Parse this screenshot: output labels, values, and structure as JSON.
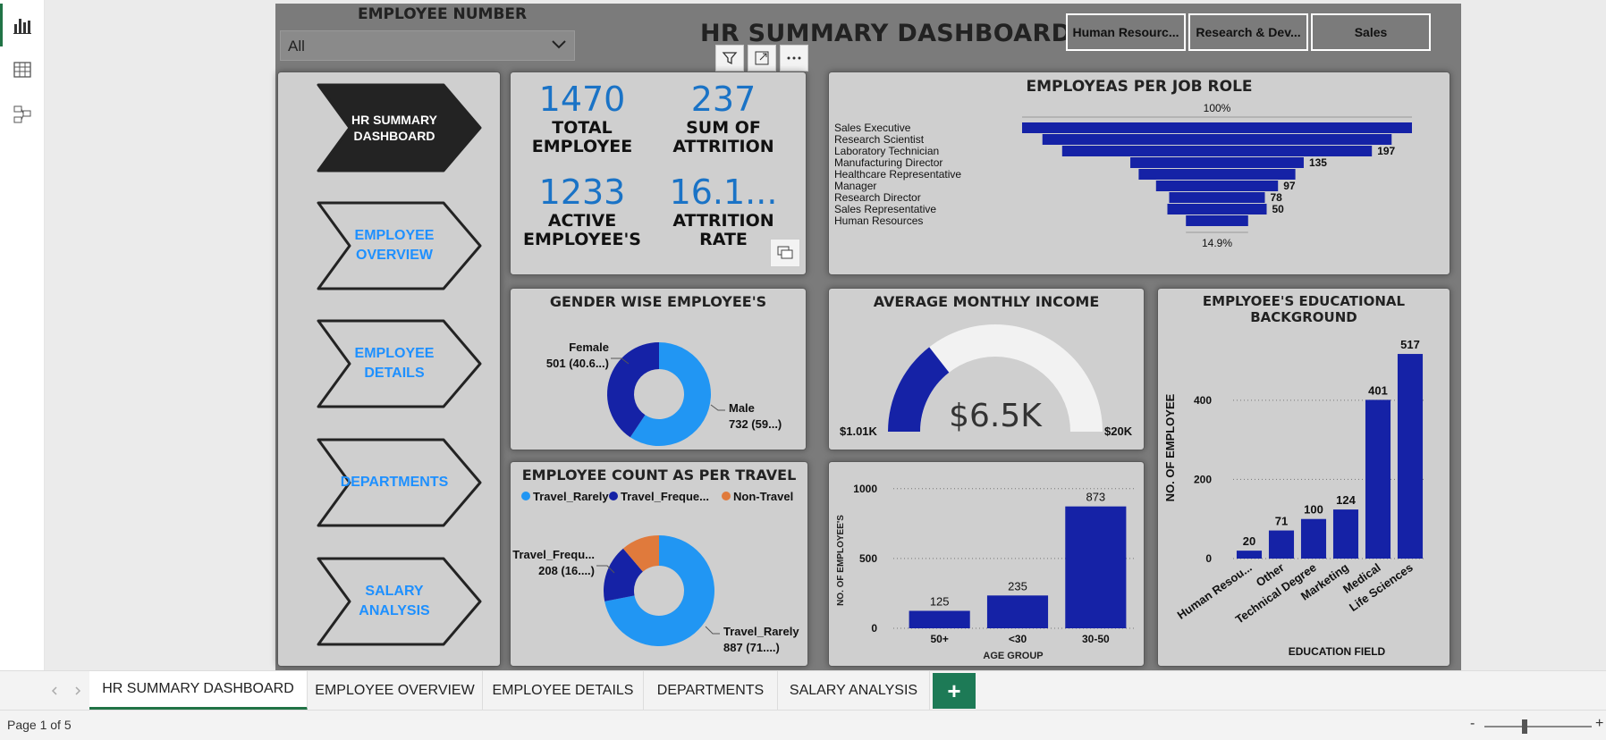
{
  "header": {
    "slicer_label": "EMPLOYEE NUMBER",
    "slicer_value": "All",
    "title": "HR SUMMARY DASHBOARD",
    "dept_buttons": [
      "Human Resourc...",
      "Research & Dev...",
      "Sales"
    ]
  },
  "nav": [
    {
      "label": "HR SUMMARY DASHBOARD",
      "active": true
    },
    {
      "label": "EMPLOYEE OVERVIEW",
      "active": false
    },
    {
      "label": "EMPLOYEE DETAILS",
      "active": false
    },
    {
      "label": "DEPARTMENTS",
      "active": false
    },
    {
      "label": "SALARY ANALYSIS",
      "active": false
    }
  ],
  "kpis": {
    "total_employee": {
      "value": "1470",
      "label1": "TOTAL",
      "label2": "EMPLOYEE"
    },
    "attrition": {
      "value": "237",
      "label1": "SUM OF",
      "label2": "ATTRITION"
    },
    "active": {
      "value": "1233",
      "label1": "ACTIVE",
      "label2": "EMPLOYEE'S"
    },
    "rate": {
      "value": "16.1...",
      "label1": "ATTRITION",
      "label2": "RATE"
    }
  },
  "colors": {
    "dark_blue": "#1522a6",
    "light_blue": "#2196f3",
    "orange": "#e07a3c",
    "accent_green": "#217346"
  },
  "chart_data": [
    {
      "id": "funnel",
      "type": "bar",
      "title": "EMPLOYEAS PER JOB ROLE",
      "top_label": "100%",
      "bottom_label": "14.9%",
      "categories": [
        "Sales Executive",
        "Research Scientist",
        "Laboratory Technician",
        "Manufacturing Director",
        "Healthcare Representative",
        "Manager",
        "Research Director",
        "Sales Representative",
        "Human Resources"
      ],
      "values": [
        326,
        292,
        259,
        145,
        131,
        102,
        80,
        83,
        52
      ],
      "data_labels": [
        "",
        "",
        "197",
        "135",
        "",
        "97",
        "78",
        "50",
        ""
      ]
    },
    {
      "id": "gender",
      "type": "pie",
      "title": "GENDER WISE EMPLOYEE'S",
      "slices": [
        {
          "name": "Female",
          "value": 501,
          "label": "501 (40.6...)",
          "color": "#1522a6"
        },
        {
          "name": "Male",
          "value": 732,
          "label": "732 (59...)",
          "color": "#2196f3"
        }
      ]
    },
    {
      "id": "income",
      "type": "gauge",
      "title": "AVERAGE MONTHLY INCOME",
      "value": 6.5,
      "min": 1.01,
      "max": 20,
      "value_label": "$6.5K",
      "min_label": "$1.01K",
      "max_label": "$20K"
    },
    {
      "id": "education",
      "type": "bar",
      "title": "EMPLYOEE'S EDUCATIONAL BACKGROUND",
      "xlabel": "EDUCATION FIELD",
      "ylabel": "NO. OF EMPLOYEE",
      "categories": [
        "Human Resou...",
        "Other",
        "Technical Degree",
        "Marketing",
        "Medical",
        "Life Sciences"
      ],
      "values": [
        20,
        71,
        100,
        124,
        401,
        517
      ],
      "yticks": [
        0,
        200,
        400
      ],
      "ylim": [
        0,
        560
      ]
    },
    {
      "id": "travel",
      "type": "pie",
      "title": "EMPLOYEE COUNT AS PER TRAVEL",
      "legend": [
        "Travel_Rarely",
        "Travel_Freque...",
        "Non-Travel"
      ],
      "slices": [
        {
          "name": "Travel_Rarely",
          "value": 887,
          "label": "887 (71....)",
          "color": "#2196f3"
        },
        {
          "name": "Travel_Frequently",
          "value": 208,
          "label": "208 (16....)",
          "color": "#1522a6"
        },
        {
          "name": "Non-Travel",
          "value": 138,
          "label": "",
          "color": "#e07a3c"
        }
      ],
      "callouts": [
        "Travel_Frequ...",
        "Travel_Rarely"
      ]
    },
    {
      "id": "age",
      "type": "bar",
      "xlabel": "AGE GROUP",
      "ylabel": "NO. OF EMPLOYEE'S",
      "categories": [
        "50+",
        "<30",
        "30-50"
      ],
      "values": [
        125,
        235,
        873
      ],
      "yticks": [
        0,
        500,
        1000
      ],
      "ylim": [
        0,
        1050
      ]
    }
  ],
  "tabs": [
    "HR SUMMARY DASHBOARD",
    "EMPLOYEE OVERVIEW",
    "EMPLOYEE DETAILS",
    "DEPARTMENTS",
    "SALARY ANALYSIS"
  ],
  "tab_add": "+",
  "status": {
    "page": "Page 1 of 5",
    "zoom_minus": "-",
    "zoom_plus": "+"
  }
}
